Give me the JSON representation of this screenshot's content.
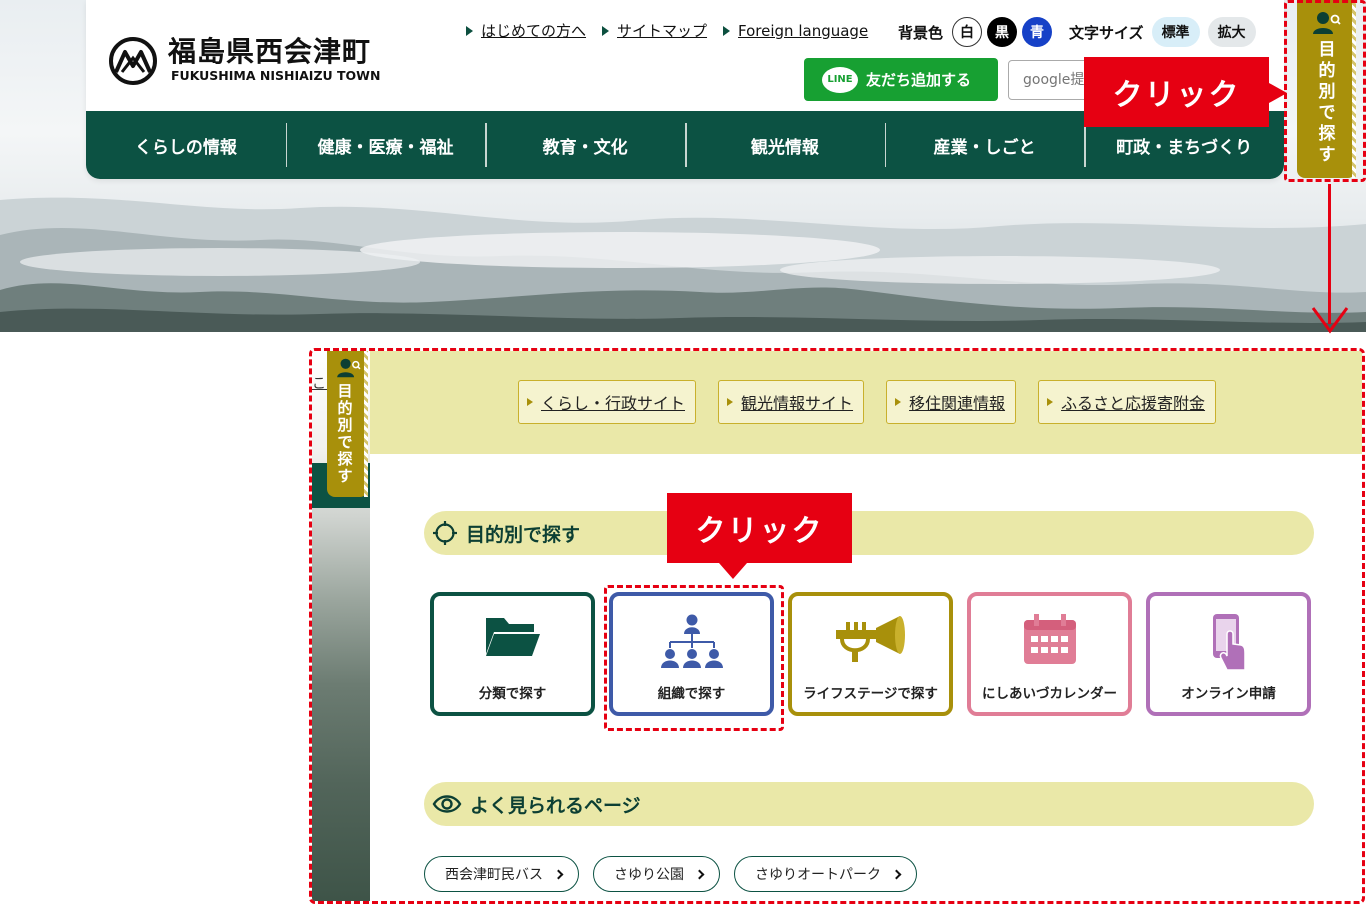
{
  "header": {
    "logo_title": "福島県西会津町",
    "logo_subtitle": "FUKUSHIMA NISHIAIZU TOWN",
    "util_links": [
      "はじめての方へ",
      "サイトマップ",
      "Foreign language"
    ],
    "bgcolor_label": "背景色",
    "bgcolor_options": [
      "白",
      "黒",
      "青"
    ],
    "fontsize_label": "文字サイズ",
    "fontsize_options": [
      "標準",
      "拡大"
    ],
    "line_button": "友だち追加する",
    "line_badge": "LINE",
    "search_placeholder": "google提供"
  },
  "global_nav": [
    "くらしの情報",
    "健康・医療・福祉",
    "教育・文化",
    "観光情報",
    "産業・しごと",
    "町政・まちづくり"
  ],
  "side_tab": {
    "label": "目的別で探す"
  },
  "callouts": {
    "top": "クリック",
    "mid": "クリック"
  },
  "panel": {
    "partial_link": "ここ",
    "site_links": [
      "くらし・行政サイト",
      "観光情報サイト",
      "移住関連情報",
      "ふるさと応援寄附金"
    ],
    "purpose_heading": "目的別で探す",
    "cards": [
      "分類で探す",
      "組織で探す",
      "ライフステージで探す",
      "にしあいづカレンダー",
      "オンライン申請"
    ],
    "popular_heading": "よく見られるページ",
    "tags": [
      "西会津町民バス",
      "さゆり公園",
      "さゆりオートパーク"
    ]
  },
  "colors": {
    "brand_green": "#0c5243",
    "gold": "#a8900b",
    "annotation_red": "#e60012",
    "panel_yellow": "#eae8a8",
    "line_green": "#17a032",
    "blue": "#1641c7"
  },
  "icons": [
    "logo-mark-icon",
    "person-search-icon",
    "folder-icon",
    "org-chart-icon",
    "trumpet-icon",
    "calendar-icon",
    "smartphone-tap-icon",
    "target-icon",
    "eye-icon",
    "chevron-right-icon",
    "down-arrow-icon"
  ]
}
